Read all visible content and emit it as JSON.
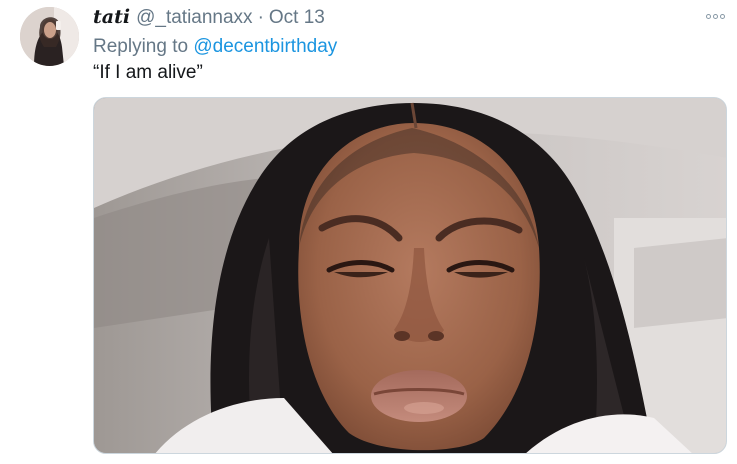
{
  "tweet": {
    "display_name": "tati",
    "handle": "@_tatiannaxx",
    "separator": "·",
    "date": "Oct 13",
    "reply_prefix": "Replying to",
    "reply_to": "@decentbirthday",
    "text": "“If I am alive”",
    "more_icon": "more-options-icon",
    "avatar": "profile-avatar",
    "media": "photo-of-woman-squinting"
  },
  "colors": {
    "name": "#14171a",
    "secondary": "#657786",
    "link": "#1b95e0",
    "border": "#ccd6dd"
  }
}
